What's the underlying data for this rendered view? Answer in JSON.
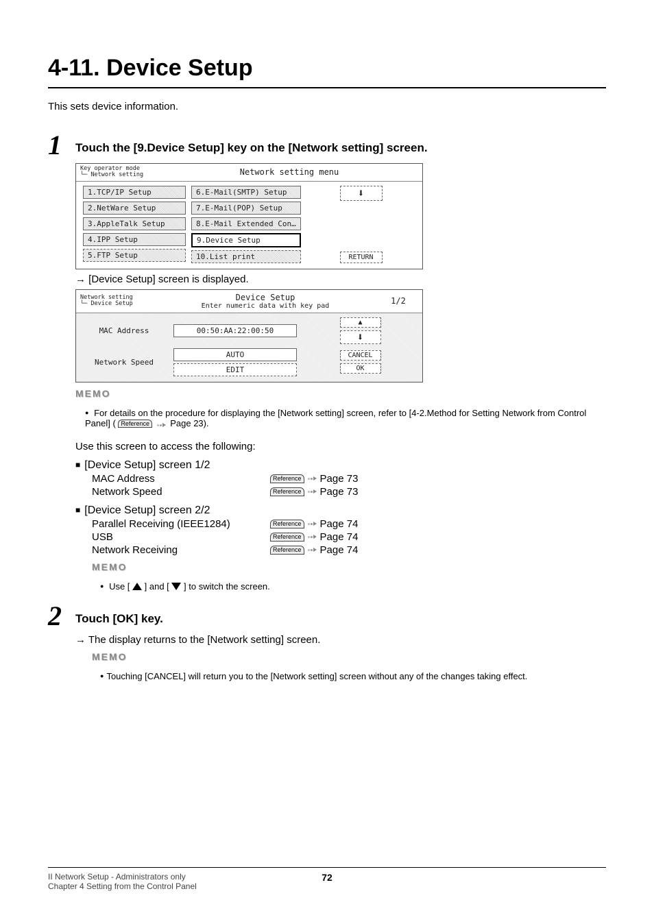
{
  "title": "4-11. Device Setup",
  "intro": "This sets device information.",
  "steps": {
    "1": {
      "num": "1",
      "heading": "Touch the [9.Device Setup] key on the [Network setting] screen.",
      "lcd1": {
        "crumb": "Key operator mode\n└─ Network setting",
        "title": "Network setting menu",
        "left": [
          "1.TCP/IP Setup",
          "2.NetWare Setup",
          "3.AppleTalk Setup",
          "4.IPP Setup",
          "5.FTP Setup"
        ],
        "mid": [
          "6.E-Mail(SMTP) Setup",
          "7.E-Mail(POP) Setup",
          "8.E-Mail Extended Confi…",
          "9.Device Setup",
          "10.List print"
        ],
        "highlight_index": 3,
        "return_btn": "RETURN"
      },
      "result": "→ [Device Setup] screen is displayed.",
      "lcd2": {
        "crumb": "Network setting\n└─ Device Setup",
        "title": "Device Setup",
        "subtitle": "Enter numeric data with key pad",
        "page": "1/2",
        "mac_label": "MAC Address",
        "mac_value": "00:50:AA:22:00:50",
        "speed_label": "Network Speed",
        "speed_value": "AUTO",
        "edit_btn": "EDIT",
        "cancel_btn": "CANCEL",
        "ok_btn": "OK"
      },
      "memo1": {
        "label": "MEMO",
        "text_a": "For details on the procedure for displaying the [Network setting] screen, refer to [4-2.Method for Setting Network from Control Panel] (",
        "ref": "Reference",
        "text_b": " Page 23)."
      },
      "access_line": "Use this screen to access the following:",
      "group1": {
        "heading": "[Device Setup] screen 1/2",
        "rows": [
          {
            "name": "MAC Address",
            "ref": "Reference",
            "page": "Page 73"
          },
          {
            "name": "Network Speed",
            "ref": "Reference",
            "page": "Page 73"
          }
        ]
      },
      "group2": {
        "heading": "[Device Setup] screen 2/2",
        "rows": [
          {
            "name": "Parallel Receiving (IEEE1284)",
            "ref": "Reference",
            "page": "Page 74"
          },
          {
            "name": "USB",
            "ref": "Reference",
            "page": "Page 74"
          },
          {
            "name": "Network Receiving",
            "ref": "Reference",
            "page": "Page 74"
          }
        ]
      },
      "memo2": {
        "label": "MEMO",
        "pre": "Use [",
        "mid": "] and [",
        "post": "] to switch the screen."
      }
    },
    "2": {
      "num": "2",
      "heading": "Touch [OK] key.",
      "result": "→ The display returns to the [Network setting] screen.",
      "memo": {
        "label": "MEMO",
        "text": "Touching [CANCEL] will return you to the [Network setting] screen without any of the changes taking effect."
      }
    }
  },
  "footer": {
    "left1": "II Network Setup - Administrators only",
    "left2": "Chapter 4 Setting from the Control Panel",
    "page": "72"
  }
}
